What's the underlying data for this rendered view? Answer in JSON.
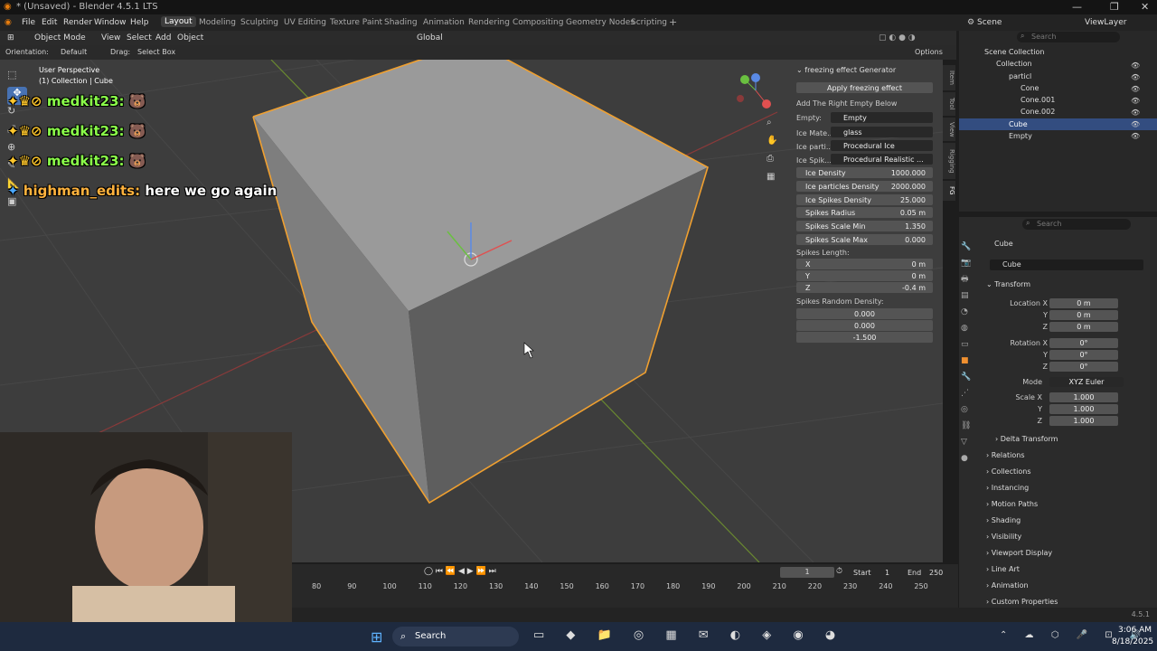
{
  "window": {
    "title": "* (Unsaved) - Blender 4.5.1 LTS"
  },
  "menu": {
    "items": [
      "File",
      "Edit",
      "Render",
      "Window",
      "Help"
    ]
  },
  "workspaces": [
    "Layout",
    "Modeling",
    "Sculpting",
    "UV Editing",
    "Texture Paint",
    "Shading",
    "Animation",
    "Rendering",
    "Compositing",
    "Geometry Nodes",
    "Scripting"
  ],
  "workspace_add": "+",
  "scene": {
    "name": "Scene",
    "view_layer": "ViewLayer"
  },
  "viewport_header": {
    "mode": "Object Mode",
    "view": "View",
    "select": "Select",
    "add": "Add",
    "object": "Object",
    "orientation": "Global"
  },
  "tool_header": {
    "orientation_label": "Orientation:",
    "orientation_value": "Default",
    "drag_label": "Drag:",
    "drag_value": "Select Box",
    "options": "Options"
  },
  "viewport": {
    "perspective": "User Perspective",
    "collection_info": "(1) Collection | Cube"
  },
  "chat": [
    {
      "user": "medkit23:",
      "message": ""
    },
    {
      "user": "medkit23:",
      "message": ""
    },
    {
      "user": "medkit23:",
      "message": ""
    },
    {
      "user": "highman_edits:",
      "message": "here we go again"
    }
  ],
  "npanel": {
    "title": "freezing effect Generator",
    "apply_button": "Apply freezing effect",
    "hint": "Add The Right Empty Below",
    "empty_label": "Empty:",
    "empty_value": "Empty",
    "material_label": "Ice Mate...",
    "material_value": "glass",
    "particles_label": "Ice parti...",
    "particles_value": "Procedural Ice",
    "spikes_label": "Ice Spik...",
    "spikes_value": "Procedural Realistic ...",
    "fields": [
      {
        "label": "Ice Density",
        "value": "1000.000"
      },
      {
        "label": "Ice particles Density",
        "value": "2000.000"
      },
      {
        "label": "Ice Spikes Density",
        "value": "25.000"
      },
      {
        "label": "Spikes Radius",
        "value": "0.05 m"
      },
      {
        "label": "Spikes Scale Min",
        "value": "1.350"
      },
      {
        "label": "Spikes Scale Max",
        "value": "0.000"
      }
    ],
    "spikes_length_label": "Spikes Length:",
    "spikes_length": [
      {
        "axis": "X",
        "value": "0 m"
      },
      {
        "axis": "Y",
        "value": "0 m"
      },
      {
        "axis": "Z",
        "value": "-0.4 m"
      }
    ],
    "random_density_label": "Spikes Random Density:",
    "random_density": [
      "0.000",
      "0.000",
      "-1.500"
    ],
    "tabs": [
      "Item",
      "Tool",
      "View",
      "Rigging",
      "FG"
    ]
  },
  "outliner": {
    "search_placeholder": "Search",
    "items": [
      {
        "label": "Scene Collection",
        "depth": 0
      },
      {
        "label": "Collection",
        "depth": 1
      },
      {
        "label": "particl",
        "depth": 2
      },
      {
        "label": "Cone",
        "depth": 3
      },
      {
        "label": "Cone.001",
        "depth": 3
      },
      {
        "label": "Cone.002",
        "depth": 3
      },
      {
        "label": "Cube",
        "depth": 2,
        "selected": true
      },
      {
        "label": "Empty",
        "depth": 2
      }
    ]
  },
  "properties": {
    "search_placeholder": "Search",
    "object_name": "Cube",
    "data_name": "Cube",
    "transform": "Transform",
    "location_label": "Location X",
    "location": [
      "0 m",
      "0 m",
      "0 m"
    ],
    "rotation_label": "Rotation X",
    "rotation": [
      "0°",
      "0°",
      "0°"
    ],
    "mode_label": "Mode",
    "mode_value": "XYZ Euler",
    "scale_label": "Scale X",
    "scale": [
      "1.000",
      "1.000",
      "1.000"
    ],
    "axis_y": "Y",
    "axis_z": "Z",
    "sections": [
      "Delta Transform",
      "Relations",
      "Collections",
      "Instancing",
      "Motion Paths",
      "Shading",
      "Visibility",
      "Viewport Display",
      "Line Art",
      "Animation",
      "Custom Properties"
    ]
  },
  "timeline": {
    "current_frame": "1",
    "start_label": "Start",
    "start": "1",
    "end_label": "End",
    "end": "250",
    "frame_numbers": [
      "80",
      "90",
      "100",
      "110",
      "120",
      "130",
      "140",
      "150",
      "160",
      "170",
      "180",
      "190",
      "200",
      "210",
      "220",
      "230",
      "240",
      "250"
    ]
  },
  "statusbar": {
    "version": "4.5.1"
  },
  "taskbar": {
    "search": "Search",
    "time": "3:06 AM",
    "date": "8/18/2025"
  }
}
